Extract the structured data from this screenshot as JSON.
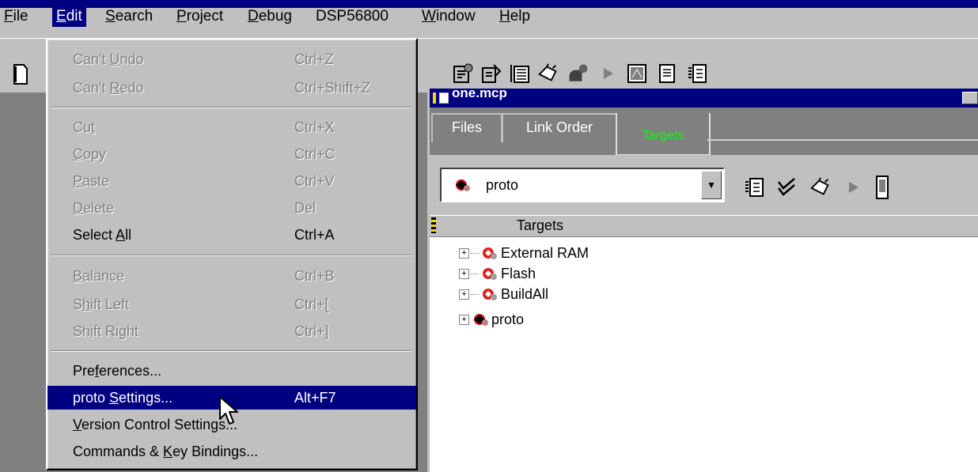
{
  "menubar": {
    "items": [
      {
        "label": "File",
        "acc": "F",
        "rest": "ile"
      },
      {
        "label": "Edit",
        "acc": "E",
        "rest": "dit"
      },
      {
        "label": "Search",
        "acc": "S",
        "rest": "earch"
      },
      {
        "label": "Project",
        "acc": "P",
        "rest": "roject"
      },
      {
        "label": "Debug",
        "acc": "D",
        "rest": "ebug"
      },
      {
        "label": "DSP56800",
        "acc": "",
        "rest": "DSP56800"
      },
      {
        "label": "Window",
        "acc": "W",
        "rest": "indow"
      },
      {
        "label": "Help",
        "acc": "H",
        "rest": "elp"
      }
    ]
  },
  "edit_menu": {
    "items": [
      {
        "label": "Can't Undo",
        "pre": "Can't ",
        "acc": "U",
        "post": "ndo",
        "shortcut": "Ctrl+Z",
        "enabled": false
      },
      {
        "label": "Can't Redo",
        "pre": "Can't ",
        "acc": "R",
        "post": "edo",
        "shortcut": "Ctrl+Shift+Z",
        "enabled": false
      },
      {
        "label": "Cut",
        "pre": "Cu",
        "acc": "t",
        "post": "",
        "shortcut": "Ctrl+X",
        "enabled": false
      },
      {
        "label": "Copy",
        "pre": "",
        "acc": "C",
        "post": "opy",
        "shortcut": "Ctrl+C",
        "enabled": false
      },
      {
        "label": "Paste",
        "pre": "",
        "acc": "P",
        "post": "aste",
        "shortcut": "Ctrl+V",
        "enabled": false
      },
      {
        "label": "Delete",
        "pre": "",
        "acc": "D",
        "post": "elete",
        "shortcut": "Del",
        "enabled": false
      },
      {
        "label": "Select All",
        "pre": "Select ",
        "acc": "A",
        "post": "ll",
        "shortcut": "Ctrl+A",
        "enabled": true
      },
      {
        "label": "Balance",
        "pre": "",
        "acc": "B",
        "post": "alance",
        "shortcut": "Ctrl+B",
        "enabled": false
      },
      {
        "label": "Shift Left",
        "pre": "S",
        "acc": "h",
        "post": "ift Left",
        "shortcut": "Ctrl+[",
        "enabled": false
      },
      {
        "label": "Shift Right",
        "pre": "Sh",
        "acc": "i",
        "post": "ft Right",
        "shortcut": "Ctrl+]",
        "enabled": false
      },
      {
        "label": "Preferences...",
        "pre": "Pre",
        "acc": "f",
        "post": "erences...",
        "shortcut": "",
        "enabled": true
      },
      {
        "label": "proto Settings...",
        "pre": "proto ",
        "acc": "S",
        "post": "ettings...",
        "shortcut": "Alt+F7",
        "enabled": true,
        "selected": true
      },
      {
        "label": "Version Control Settings...",
        "pre": "",
        "acc": "V",
        "post": "ersion Control Settings...",
        "shortcut": "",
        "enabled": true
      },
      {
        "label": "Commands & Key Bindings...",
        "pre": "Commands & ",
        "acc": "K",
        "post": "ey Bindings...",
        "shortcut": "",
        "enabled": true
      }
    ]
  },
  "project_window": {
    "title": "one.mcp",
    "tabs": [
      "Files",
      "Link Order",
      "Targets"
    ],
    "active_tab": "Targets",
    "current_target": "proto",
    "column_header": "Targets",
    "targets": [
      "External RAM",
      "Flash",
      "BuildAll",
      "proto"
    ]
  },
  "colors": {
    "menu_highlight": "#000080",
    "active_tab_text": "#00ff00",
    "face": "#c0c0c0",
    "dark": "#808080"
  },
  "icons": {
    "toolbar": [
      "new-file-icon",
      "make-icon",
      "make-all-icon",
      "list-icon",
      "debug-icon",
      "run-icon",
      "play-icon",
      "window-icon",
      "document-icon",
      "settings-icon"
    ],
    "target_bar": [
      "target-settings-icon",
      "synchronize-icon",
      "debug-icon",
      "run-icon",
      "device-icon"
    ]
  }
}
